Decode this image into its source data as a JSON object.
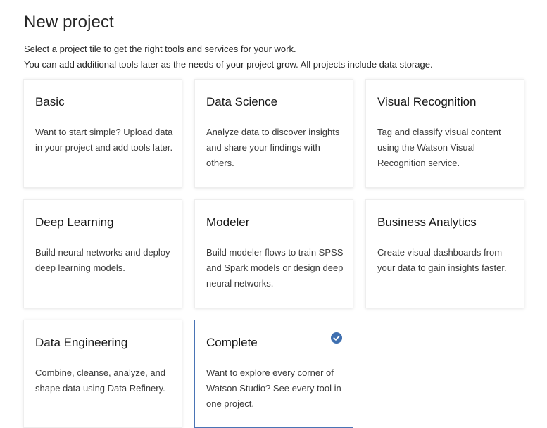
{
  "header": {
    "title": "New project",
    "subtitle_line1": "Select a project tile to get the right tools and services for your work.",
    "subtitle_line2": "You can add additional tools later as the needs of your project grow. All projects include data storage."
  },
  "tiles": [
    {
      "title": "Basic",
      "description": "Want to start simple? Upload data in your project and add tools later.",
      "selected": false
    },
    {
      "title": "Data Science",
      "description": "Analyze data to discover insights and share your findings with others.",
      "selected": false
    },
    {
      "title": "Visual Recognition",
      "description": "Tag and classify visual content using the Watson Visual Recognition service.",
      "selected": false
    },
    {
      "title": "Deep Learning",
      "description": "Build neural networks and deploy deep learning models.",
      "selected": false
    },
    {
      "title": "Modeler",
      "description": "Build modeler flows to train SPSS and Spark models or design deep neural networks.",
      "selected": false
    },
    {
      "title": "Business Analytics",
      "description": "Create visual dashboards from your data to gain insights faster.",
      "selected": false
    },
    {
      "title": "Data Engineering",
      "description": "Combine, cleanse, analyze, and shape data using Data Refinery.",
      "selected": false
    },
    {
      "title": "Complete",
      "description": "Want to explore every corner of Watson Studio? See every tool in one project.",
      "selected": true
    }
  ],
  "colors": {
    "selected_border": "#4a74b5",
    "check_icon": "#3e6fb0"
  },
  "icons": {
    "selected_indicator": "checkmark-circle-icon"
  }
}
